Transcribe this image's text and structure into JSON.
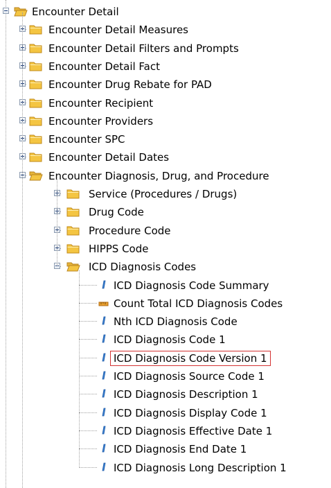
{
  "tree": {
    "root": {
      "label": "Encounter Detail",
      "icon": "folder-open-icon",
      "state": "expanded"
    },
    "level1": [
      {
        "label": "Encounter Detail Measures",
        "icon": "folder-icon",
        "state": "collapsed"
      },
      {
        "label": "Encounter Detail Filters and Prompts",
        "icon": "folder-icon",
        "state": "collapsed"
      },
      {
        "label": "Encounter Detail Fact",
        "icon": "folder-icon",
        "state": "collapsed"
      },
      {
        "label": "Encounter Drug Rebate for PAD",
        "icon": "folder-icon",
        "state": "collapsed"
      },
      {
        "label": "Encounter Recipient",
        "icon": "folder-icon",
        "state": "collapsed"
      },
      {
        "label": "Encounter Providers",
        "icon": "folder-icon",
        "state": "collapsed"
      },
      {
        "label": "Encounter SPC",
        "icon": "folder-icon",
        "state": "collapsed"
      },
      {
        "label": "Encounter Detail Dates",
        "icon": "folder-icon",
        "state": "collapsed"
      },
      {
        "label": "Encounter Diagnosis, Drug, and Procedure",
        "icon": "folder-open-icon",
        "state": "expanded"
      }
    ],
    "level2": [
      {
        "label": "Service (Procedures / Drugs)",
        "icon": "folder-icon",
        "state": "collapsed"
      },
      {
        "label": "Drug Code",
        "icon": "folder-icon",
        "state": "collapsed"
      },
      {
        "label": "Procedure Code",
        "icon": "folder-icon",
        "state": "collapsed"
      },
      {
        "label": "HIPPS Code",
        "icon": "folder-icon",
        "state": "collapsed"
      },
      {
        "label": "ICD Diagnosis Codes",
        "icon": "folder-open-icon",
        "state": "expanded"
      }
    ],
    "level3": [
      {
        "label": "ICD Diagnosis Code Summary",
        "icon": "dimension-icon"
      },
      {
        "label": "Count Total ICD Diagnosis Codes",
        "icon": "measure-icon"
      },
      {
        "label": "Nth ICD Diagnosis Code",
        "icon": "dimension-icon"
      },
      {
        "label": "ICD Diagnosis Code 1",
        "icon": "dimension-icon"
      },
      {
        "label": "ICD Diagnosis Code Version 1",
        "icon": "dimension-icon",
        "selected": true
      },
      {
        "label": "ICD Diagnosis Source Code 1",
        "icon": "dimension-icon"
      },
      {
        "label": "ICD Diagnosis Description 1",
        "icon": "dimension-icon"
      },
      {
        "label": "ICD Diagnosis Display Code 1",
        "icon": "dimension-icon"
      },
      {
        "label": "ICD Diagnosis Effective Date 1",
        "icon": "dimension-icon"
      },
      {
        "label": "ICD Diagnosis End Date 1",
        "icon": "dimension-icon"
      },
      {
        "label": "ICD Diagnosis Long Description 1",
        "icon": "dimension-icon"
      }
    ],
    "colors": {
      "selection_border": "#d43232",
      "folder": "#f4c542",
      "dimension": "#3f86d6",
      "measure": "#e8a030"
    }
  }
}
